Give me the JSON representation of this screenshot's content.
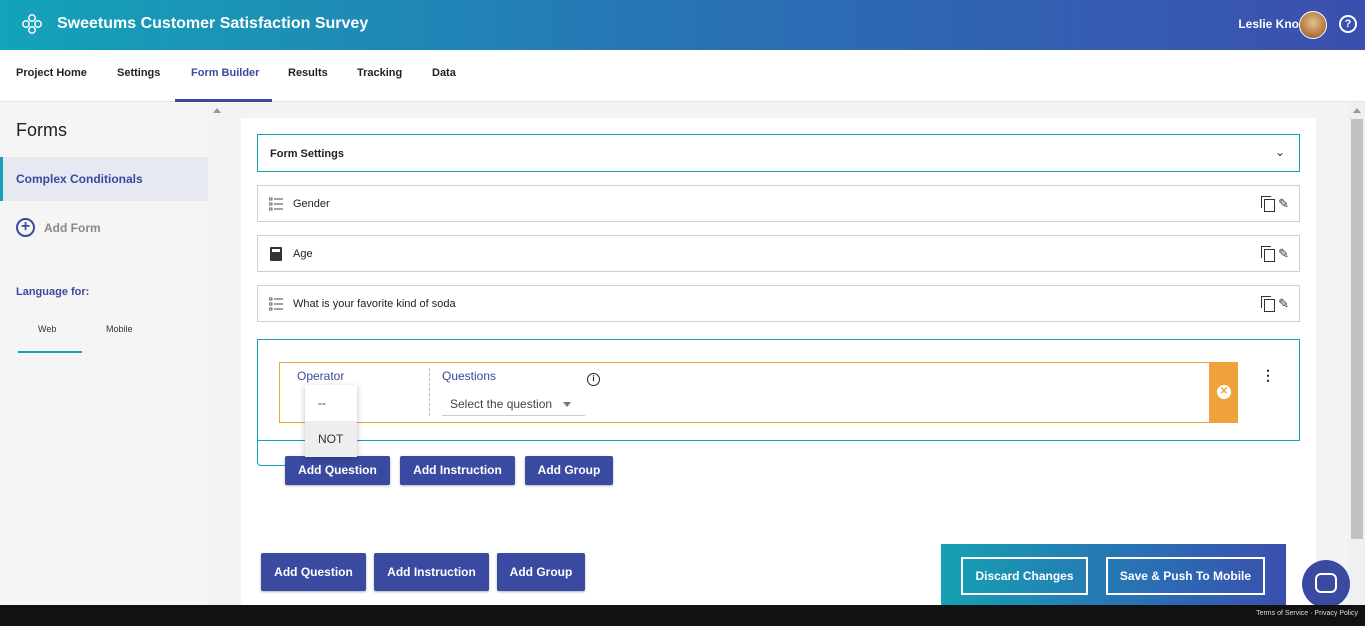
{
  "app": {
    "title": "Sweetums Customer Satisfaction Survey",
    "user_name": "Leslie Knope",
    "help_label": "?"
  },
  "nav": {
    "tabs": [
      "Project Home",
      "Settings",
      "Form Builder",
      "Results",
      "Tracking",
      "Data"
    ],
    "active": "Form Builder"
  },
  "sidebar": {
    "title": "Forms",
    "active_form": "Complex Conditionals",
    "add_form_label": "Add Form",
    "add_form_icon": "+",
    "language_label": "Language for:",
    "language_tabs": [
      "Web",
      "Mobile"
    ],
    "active_language": "Web"
  },
  "form": {
    "settings_label": "Form Settings",
    "chevron": "⌄",
    "questions": [
      {
        "label": "Gender",
        "icon": "list-icon"
      },
      {
        "label": "Age",
        "icon": "calculator-icon"
      },
      {
        "label": "What is your favorite kind of soda",
        "icon": "list-icon"
      }
    ],
    "edit_glyph": "✎"
  },
  "condition": {
    "operator_label": "Operator",
    "questions_label": "Questions",
    "info_glyph": "i",
    "select_placeholder": "Select the question",
    "close_glyph": "✕",
    "kebab_glyph": "⋮",
    "operator_options": [
      "--",
      "NOT"
    ],
    "hovered_option": "NOT"
  },
  "inner_buttons": {
    "add_question": "Add Question",
    "add_instruction": "Add Instruction",
    "add_group": "Add Group"
  },
  "bottom_buttons": {
    "add_question": "Add Question",
    "add_instruction": "Add Instruction",
    "add_group": "Add Group"
  },
  "save_bar": {
    "discard": "Discard Changes",
    "save_push": "Save & Push To Mobile"
  },
  "footer": {
    "text": "Terms of Service · Privacy Policy"
  },
  "colors": {
    "brand_blue": "#3a4aa0",
    "teal": "#16a0b3",
    "orange": "#f0a23a"
  }
}
